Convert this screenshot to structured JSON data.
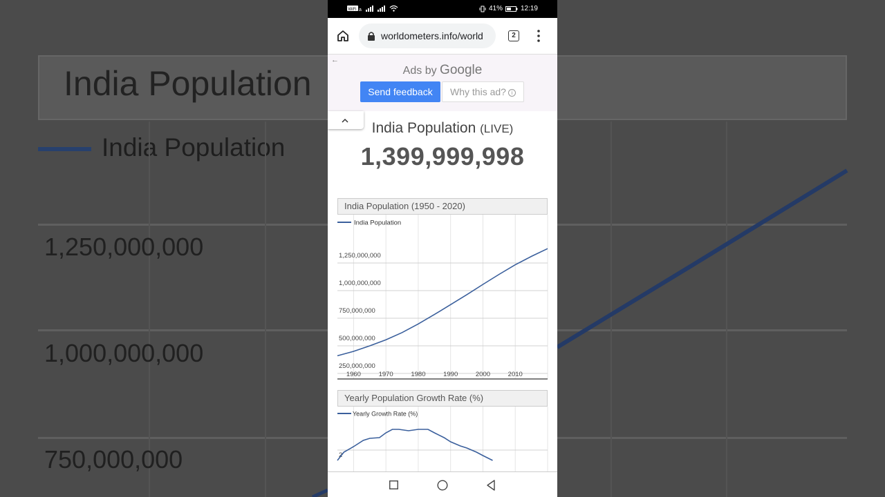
{
  "background": {
    "title": "India Population",
    "legend": "India Population",
    "ticks": [
      "1,250,000,000",
      "1,000,000,000",
      "750,000,000"
    ]
  },
  "status_bar": {
    "battery": "41%",
    "time": "12:19"
  },
  "browser": {
    "url": "worldometers.info/world",
    "tab_count": "2"
  },
  "ad": {
    "ads_by": "Ads by",
    "brand": "Google",
    "send_feedback": "Send feedback",
    "why_this_ad": "Why this ad?"
  },
  "population": {
    "title": "India Population",
    "live": "(LIVE)",
    "count": "1,399,999,998"
  },
  "charts": {
    "population_chart": {
      "header": "India Population (1950 - 2020)",
      "legend": "India Population"
    },
    "growth_chart": {
      "header": "Yearly Population Growth Rate (%)",
      "legend": "Yearly Growth Rate (%)"
    }
  },
  "chart_data": [
    {
      "type": "line",
      "title": "India Population (1950 - 2020)",
      "series": [
        {
          "name": "India Population",
          "x": [
            1955,
            1960,
            1965,
            1970,
            1975,
            1980,
            1985,
            1990,
            1995,
            2000,
            2005,
            2010,
            2015,
            2020
          ],
          "y": [
            410000000,
            450000000,
            500000000,
            555000000,
            620000000,
            698000000,
            784000000,
            873000000,
            963000000,
            1056000000,
            1147000000,
            1234000000,
            1310000000,
            1380000000
          ]
        }
      ],
      "xticks": [
        "1960",
        "1970",
        "1980",
        "1990",
        "2000",
        "2010"
      ],
      "yticks": [
        "250,000,000",
        "500,000,000",
        "750,000,000",
        "1,000,000,000",
        "1,250,000,000"
      ],
      "xlim": [
        1955,
        2020
      ],
      "ylim": [
        200000000,
        1450000000
      ],
      "grid": true,
      "legend": "top-left"
    },
    {
      "type": "line",
      "title": "Yearly Population Growth Rate (%)",
      "series": [
        {
          "name": "Yearly Growth Rate (%)",
          "x": [
            1955,
            1957,
            1960,
            1963,
            1965,
            1968,
            1970,
            1972,
            1974,
            1977,
            1980,
            1983,
            1985,
            1988,
            1990,
            1993,
            1995,
            1998,
            2000,
            2003
          ],
          "y": [
            1.85,
            1.97,
            2.05,
            2.14,
            2.17,
            2.18,
            2.25,
            2.3,
            2.3,
            2.28,
            2.3,
            2.3,
            2.25,
            2.18,
            2.12,
            2.06,
            2.03,
            1.97,
            1.92,
            1.85
          ]
        }
      ],
      "yticks": [
        "2"
      ],
      "xlim": [
        1955,
        2020
      ],
      "grid": true,
      "legend": "top-left"
    }
  ]
}
